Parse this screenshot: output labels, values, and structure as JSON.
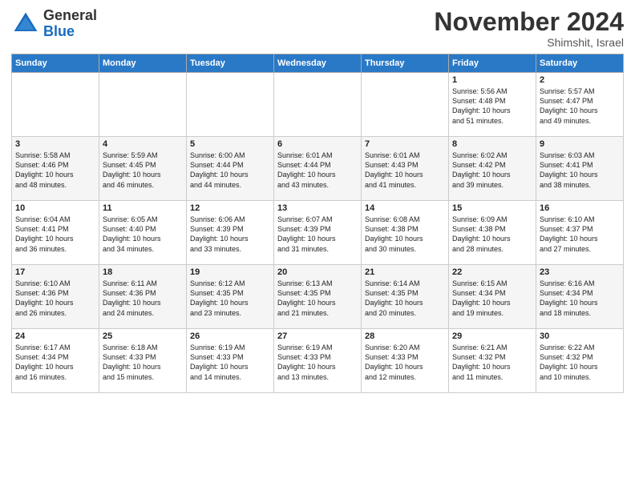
{
  "header": {
    "logo_line1": "General",
    "logo_line2": "Blue",
    "month": "November 2024",
    "location": "Shimshit, Israel"
  },
  "days_of_week": [
    "Sunday",
    "Monday",
    "Tuesday",
    "Wednesday",
    "Thursday",
    "Friday",
    "Saturday"
  ],
  "weeks": [
    [
      {
        "day": "",
        "content": ""
      },
      {
        "day": "",
        "content": ""
      },
      {
        "day": "",
        "content": ""
      },
      {
        "day": "",
        "content": ""
      },
      {
        "day": "",
        "content": ""
      },
      {
        "day": "1",
        "content": "Sunrise: 5:56 AM\nSunset: 4:48 PM\nDaylight: 10 hours\nand 51 minutes."
      },
      {
        "day": "2",
        "content": "Sunrise: 5:57 AM\nSunset: 4:47 PM\nDaylight: 10 hours\nand 49 minutes."
      }
    ],
    [
      {
        "day": "3",
        "content": "Sunrise: 5:58 AM\nSunset: 4:46 PM\nDaylight: 10 hours\nand 48 minutes."
      },
      {
        "day": "4",
        "content": "Sunrise: 5:59 AM\nSunset: 4:45 PM\nDaylight: 10 hours\nand 46 minutes."
      },
      {
        "day": "5",
        "content": "Sunrise: 6:00 AM\nSunset: 4:44 PM\nDaylight: 10 hours\nand 44 minutes."
      },
      {
        "day": "6",
        "content": "Sunrise: 6:01 AM\nSunset: 4:44 PM\nDaylight: 10 hours\nand 43 minutes."
      },
      {
        "day": "7",
        "content": "Sunrise: 6:01 AM\nSunset: 4:43 PM\nDaylight: 10 hours\nand 41 minutes."
      },
      {
        "day": "8",
        "content": "Sunrise: 6:02 AM\nSunset: 4:42 PM\nDaylight: 10 hours\nand 39 minutes."
      },
      {
        "day": "9",
        "content": "Sunrise: 6:03 AM\nSunset: 4:41 PM\nDaylight: 10 hours\nand 38 minutes."
      }
    ],
    [
      {
        "day": "10",
        "content": "Sunrise: 6:04 AM\nSunset: 4:41 PM\nDaylight: 10 hours\nand 36 minutes."
      },
      {
        "day": "11",
        "content": "Sunrise: 6:05 AM\nSunset: 4:40 PM\nDaylight: 10 hours\nand 34 minutes."
      },
      {
        "day": "12",
        "content": "Sunrise: 6:06 AM\nSunset: 4:39 PM\nDaylight: 10 hours\nand 33 minutes."
      },
      {
        "day": "13",
        "content": "Sunrise: 6:07 AM\nSunset: 4:39 PM\nDaylight: 10 hours\nand 31 minutes."
      },
      {
        "day": "14",
        "content": "Sunrise: 6:08 AM\nSunset: 4:38 PM\nDaylight: 10 hours\nand 30 minutes."
      },
      {
        "day": "15",
        "content": "Sunrise: 6:09 AM\nSunset: 4:38 PM\nDaylight: 10 hours\nand 28 minutes."
      },
      {
        "day": "16",
        "content": "Sunrise: 6:10 AM\nSunset: 4:37 PM\nDaylight: 10 hours\nand 27 minutes."
      }
    ],
    [
      {
        "day": "17",
        "content": "Sunrise: 6:10 AM\nSunset: 4:36 PM\nDaylight: 10 hours\nand 26 minutes."
      },
      {
        "day": "18",
        "content": "Sunrise: 6:11 AM\nSunset: 4:36 PM\nDaylight: 10 hours\nand 24 minutes."
      },
      {
        "day": "19",
        "content": "Sunrise: 6:12 AM\nSunset: 4:35 PM\nDaylight: 10 hours\nand 23 minutes."
      },
      {
        "day": "20",
        "content": "Sunrise: 6:13 AM\nSunset: 4:35 PM\nDaylight: 10 hours\nand 21 minutes."
      },
      {
        "day": "21",
        "content": "Sunrise: 6:14 AM\nSunset: 4:35 PM\nDaylight: 10 hours\nand 20 minutes."
      },
      {
        "day": "22",
        "content": "Sunrise: 6:15 AM\nSunset: 4:34 PM\nDaylight: 10 hours\nand 19 minutes."
      },
      {
        "day": "23",
        "content": "Sunrise: 6:16 AM\nSunset: 4:34 PM\nDaylight: 10 hours\nand 18 minutes."
      }
    ],
    [
      {
        "day": "24",
        "content": "Sunrise: 6:17 AM\nSunset: 4:34 PM\nDaylight: 10 hours\nand 16 minutes."
      },
      {
        "day": "25",
        "content": "Sunrise: 6:18 AM\nSunset: 4:33 PM\nDaylight: 10 hours\nand 15 minutes."
      },
      {
        "day": "26",
        "content": "Sunrise: 6:19 AM\nSunset: 4:33 PM\nDaylight: 10 hours\nand 14 minutes."
      },
      {
        "day": "27",
        "content": "Sunrise: 6:19 AM\nSunset: 4:33 PM\nDaylight: 10 hours\nand 13 minutes."
      },
      {
        "day": "28",
        "content": "Sunrise: 6:20 AM\nSunset: 4:33 PM\nDaylight: 10 hours\nand 12 minutes."
      },
      {
        "day": "29",
        "content": "Sunrise: 6:21 AM\nSunset: 4:32 PM\nDaylight: 10 hours\nand 11 minutes."
      },
      {
        "day": "30",
        "content": "Sunrise: 6:22 AM\nSunset: 4:32 PM\nDaylight: 10 hours\nand 10 minutes."
      }
    ]
  ]
}
